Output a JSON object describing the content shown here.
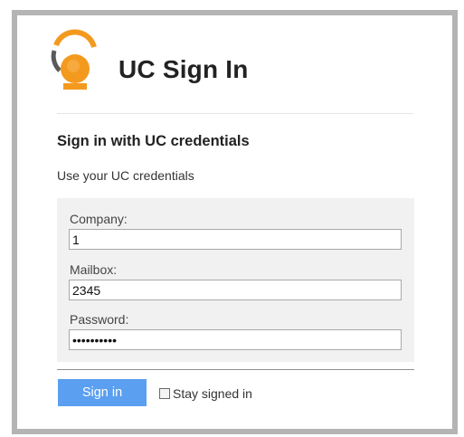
{
  "header": {
    "app_title": "UC Sign In",
    "logo_icon": "uc-logo-icon"
  },
  "colors": {
    "logo_orange": "#f39a1e",
    "logo_gray": "#5a5a5a",
    "button_blue": "#5a9ff0",
    "frame_gray": "#b4b4b4"
  },
  "signin": {
    "title": "Sign in with UC credentials",
    "subtitle": "Use your UC credentials"
  },
  "form": {
    "company": {
      "label": "Company:",
      "value": "1"
    },
    "mailbox": {
      "label": "Mailbox:",
      "value": "2345"
    },
    "password": {
      "label": "Password:",
      "value": "1234567890"
    }
  },
  "actions": {
    "signin_label": "Sign in",
    "stay_signed_in_label": "Stay signed in",
    "stay_signed_in_checked": false
  }
}
